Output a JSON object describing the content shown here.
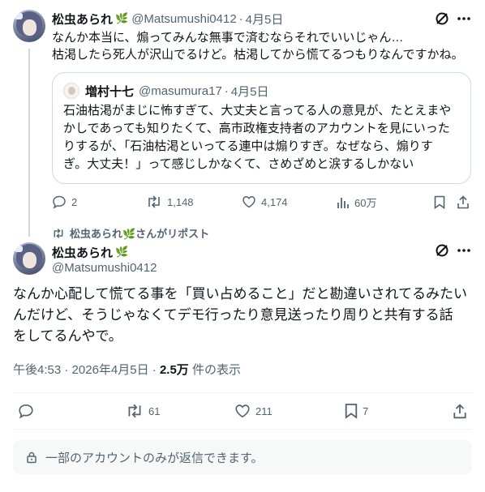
{
  "top_tweet": {
    "author_name": "松虫あられ",
    "author_badge_icon": "leaf-icon",
    "handle": "@Matsumushi0412",
    "separator": "·",
    "date": "4月5日",
    "lines": [
      "なんか本当に、煽ってみんな無事で済むならそれでいいじゃん…",
      "枯渇したら死人が沢山でるけど。枯渇してから慌てるつもりなんですかね。"
    ],
    "quote": {
      "author_name": "増村十七",
      "handle": "@masumura17",
      "separator": "·",
      "date": "4月5日",
      "lines": [
        "石油枯渇がまじに怖すぎて、大丈夫と言ってる人の意見が、たとえまや",
        "かしであっても知りたくて、高市政権支持者のアカウントを見にいった",
        "りするが、「石油枯渇といってる連中は煽りすぎ。なぜなら、煽りす",
        "ぎ。大丈夫！」って感じしかなくて、さめざめと涙するしかない"
      ]
    },
    "actions": {
      "replies": "2",
      "reposts": "1,148",
      "likes": "4,174",
      "views": "60万"
    }
  },
  "repost_label": "松虫あられ🌿さんがリポスト",
  "main_tweet": {
    "author_name": "松虫あられ",
    "handle": "@Matsumushi0412",
    "lines": [
      "なんか心配して慌てる事を「買い占めること」だと勘違いされてるみたい",
      "んだけど、そうじゃなくてデモ行ったり意見送ったり周りと共有する話",
      "をしてるんやで。"
    ],
    "time": "午後4:53",
    "separator": "·",
    "date": "2026年4月5日",
    "views_count": "2.5万",
    "views_label": "件の表示",
    "actions": {
      "replies": "",
      "reposts": "61",
      "likes": "211",
      "bookmarks": "7"
    }
  },
  "reply_notice": "一部のアカウントのみが返信できます。",
  "colors": {
    "text": "#0f1419",
    "secondary": "#536471",
    "border": "#cfd9de",
    "notice_bg": "#f7f9f9"
  }
}
